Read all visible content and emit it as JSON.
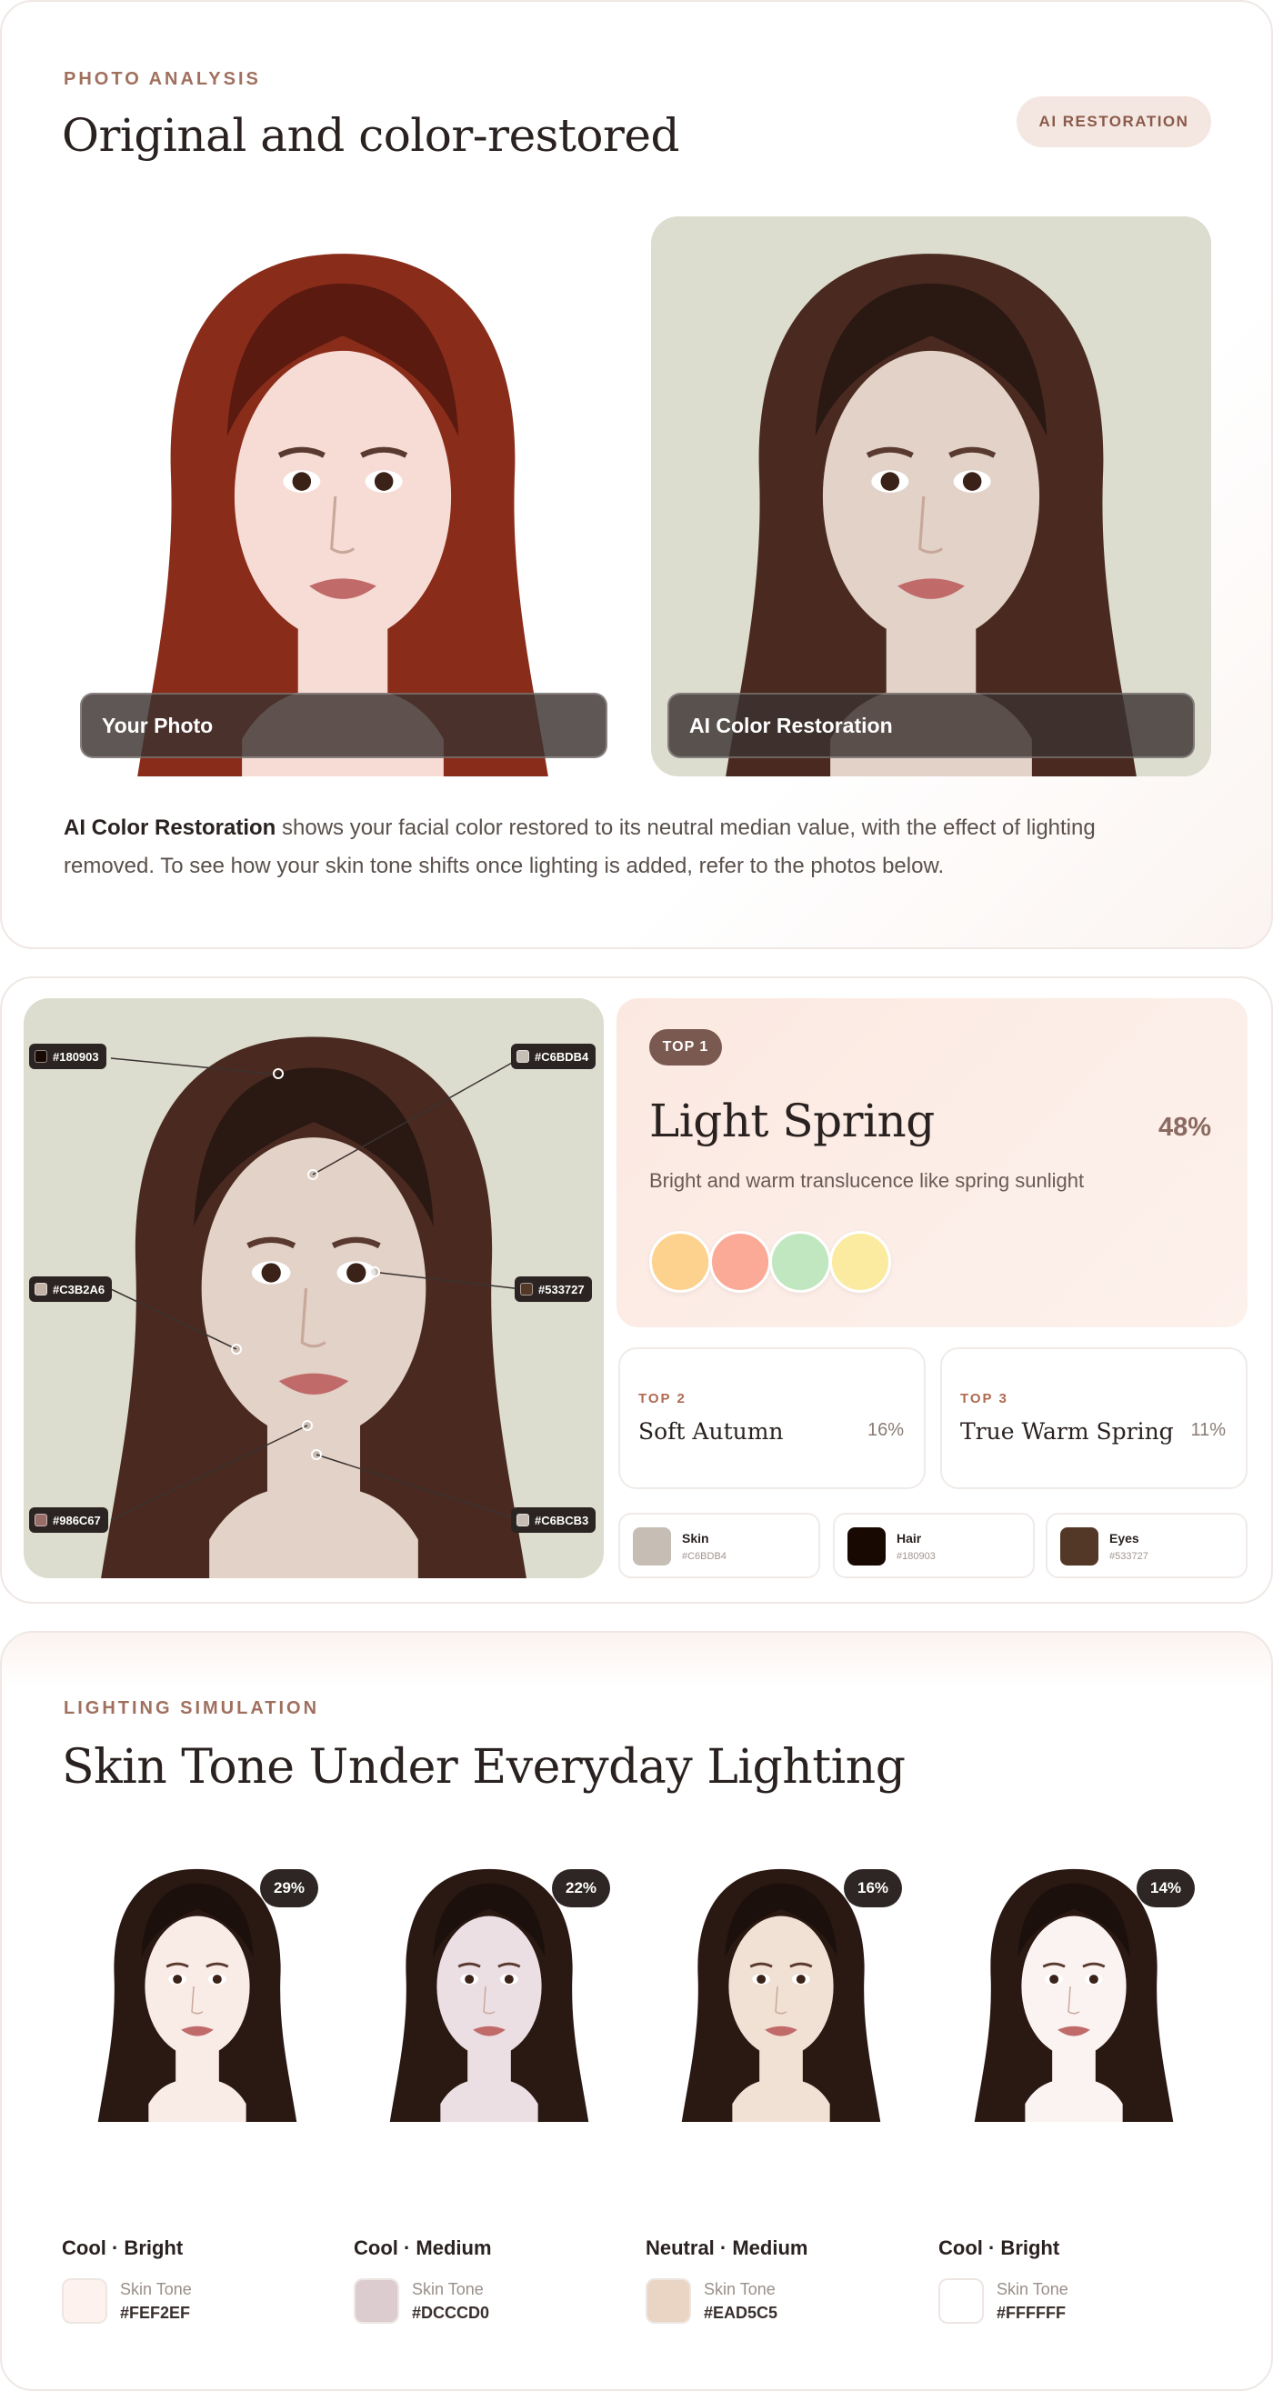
{
  "analysis": {
    "eyebrow": "PHOTO ANALYSIS",
    "title": "Original and color-restored",
    "badge": "AI RESTORATION",
    "photos": [
      {
        "caption": "Your Photo",
        "hair": "#8a2c1a",
        "hair_dark": "#5a1a10",
        "skin": "#f7dcd5",
        "bg": "#ffffff"
      },
      {
        "caption": "AI Color Restoration",
        "hair": "#4a2a20",
        "hair_dark": "#2a1812",
        "skin": "#e2d2c7",
        "bg": "#dcdccf"
      }
    ],
    "desc_bold": "AI Color Restoration",
    "desc_rest": " shows your facial color restored to its neutral median value, with the effect of lighting removed. To see how your skin tone shifts once lighting is added, refer to the photos below."
  },
  "season": {
    "markers": [
      {
        "hex": "#180903",
        "color": "#180903"
      },
      {
        "hex": "#C6BDB4",
        "color": "#C6BDB4"
      },
      {
        "hex": "#C3B2A6",
        "color": "#C3B2A6"
      },
      {
        "hex": "#533727",
        "color": "#533727"
      },
      {
        "hex": "#986C67",
        "color": "#986C67"
      },
      {
        "hex": "#C6BCB3",
        "color": "#C6BCB3"
      }
    ],
    "top1": {
      "badge": "TOP 1",
      "name": "Light Spring",
      "pct": "48%",
      "desc": "Bright and warm translucence like spring sunlight",
      "palette": [
        "#fdd28e",
        "#fcaa98",
        "#c1e7c0",
        "#fbeba0"
      ]
    },
    "top2": {
      "label": "TOP 2",
      "name": "Soft Autumn",
      "pct": "16%"
    },
    "top3": {
      "label": "TOP 3",
      "name": "True Warm Spring",
      "pct": "11%"
    },
    "chips": [
      {
        "label": "Skin",
        "hex": "#C6BDB4",
        "color": "#C6BDB4"
      },
      {
        "label": "Hair",
        "hex": "#180903",
        "color": "#180903"
      },
      {
        "label": "Eyes",
        "hex": "#533727",
        "color": "#533727"
      }
    ]
  },
  "lighting": {
    "eyebrow": "LIGHTING SIMULATION",
    "title": "Skin Tone Under Everyday Lighting",
    "items": [
      {
        "pct": "29%",
        "title": "Cool · Bright",
        "tone_label": "Skin Tone",
        "hex": "#FEF2EF",
        "skin": "#f9ebe6"
      },
      {
        "pct": "22%",
        "title": "Cool · Medium",
        "tone_label": "Skin Tone",
        "hex": "#DCCCD0",
        "skin": "#ecdfe3"
      },
      {
        "pct": "16%",
        "title": "Neutral · Medium",
        "tone_label": "Skin Tone",
        "hex": "#EAD5C5",
        "skin": "#f1e0d4"
      },
      {
        "pct": "14%",
        "title": "Cool · Bright",
        "tone_label": "Skin Tone",
        "hex": "#FFFFFF",
        "skin": "#fbf3f1"
      }
    ]
  }
}
